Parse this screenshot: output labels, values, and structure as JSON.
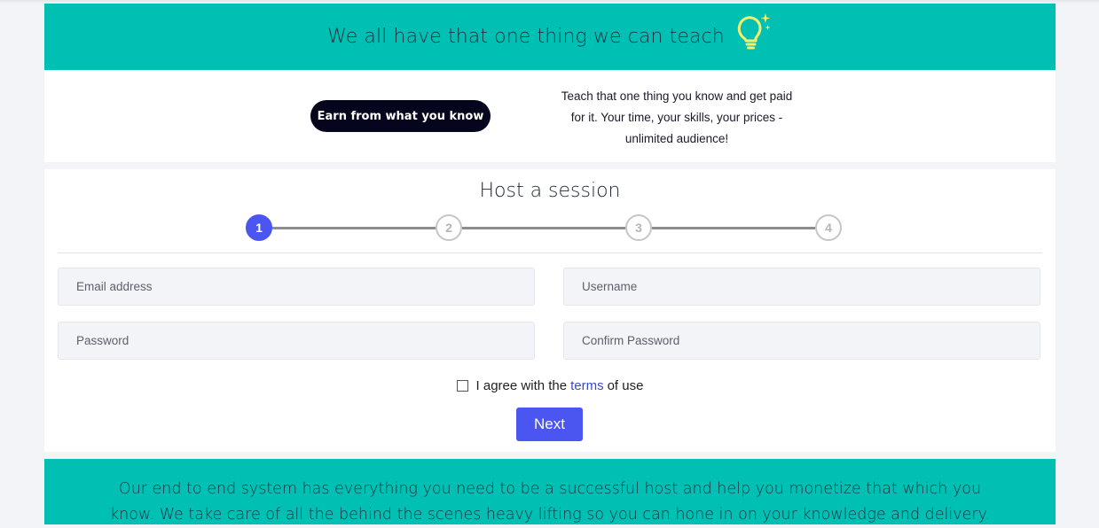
{
  "hero": {
    "title": "We all have that one thing we can teach",
    "icon": "lightbulb-icon",
    "background": "#00bfb3"
  },
  "intro": {
    "button_label": "Earn from what you know",
    "description": "Teach that one thing you know and get paid for it. Your time, your skills, your prices - unlimited audience!"
  },
  "form": {
    "title": "Host a session",
    "steps": [
      "1",
      "2",
      "3",
      "4"
    ],
    "active_step": 1,
    "email_placeholder": "Email address",
    "username_placeholder": "Username",
    "password_placeholder": "Password",
    "confirm_password_placeholder": "Confirm Password",
    "agree_prefix": "I agree with the",
    "terms_link": "terms",
    "agree_suffix": "of use",
    "next_label": "Next",
    "accent": "#4b55f0"
  },
  "footer": {
    "text": "Our end to end system has everything you need to be a successful host and help you monetize that which you know. We take care of all the behind the scenes heavy lifting so you can hone in on your knowledge and delivery."
  }
}
